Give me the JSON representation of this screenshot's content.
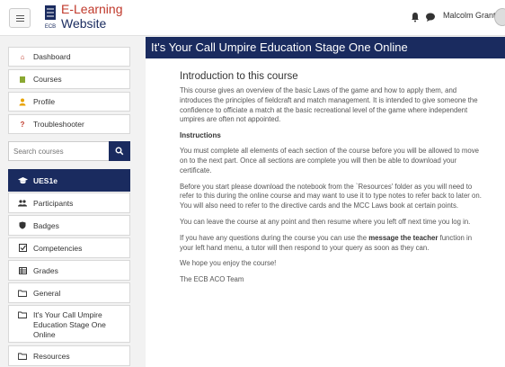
{
  "header": {
    "brand_line1": "E-Learning",
    "brand_line2": "Website",
    "user_name": "Malcolm Grant",
    "crest_text": "ECB"
  },
  "sidebar": {
    "items_top": [
      {
        "label": "Dashboard",
        "icon": "home-icon"
      },
      {
        "label": "Courses",
        "icon": "book-icon"
      },
      {
        "label": "Profile",
        "icon": "user-icon"
      },
      {
        "label": "Troubleshooter",
        "icon": "question-icon"
      }
    ],
    "search_placeholder": "Search courses",
    "course_title": "UES1e",
    "course_items": [
      {
        "label": "Participants",
        "icon": "users-icon"
      },
      {
        "label": "Badges",
        "icon": "shield-icon"
      },
      {
        "label": "Competencies",
        "icon": "checkbox-icon"
      },
      {
        "label": "Grades",
        "icon": "table-icon"
      },
      {
        "label": "General",
        "icon": "folder-icon"
      },
      {
        "label": "It's Your Call Umpire Education Stage One Online",
        "icon": "folder-icon"
      },
      {
        "label": "Resources",
        "icon": "folder-icon"
      }
    ]
  },
  "main": {
    "page_title": "It's Your Call Umpire Education Stage One Online",
    "intro_title": "Introduction to this course",
    "intro_text": "This course gives an overview of the basic Laws of the game and how to apply them, and introduces the principles of fieldcraft and match management. It is intended to give someone the confidence to officiate a match at the basic recreational level of the game where independent umpires are often not appointed.",
    "instructions_heading": "Instructions",
    "p1": "You must complete all elements of each section of the course before you will be allowed to move on to the next part. Once all sections are complete you will then be able to download your certificate.",
    "p2": "Before you start please download the notebook from the `Resources' folder as you will need to refer to this during the online course and may want to use it to type notes to refer back to later on. You will also need to refer to the directive cards and the MCC Laws book at certain points.",
    "p3": "You can leave the course at any point and then resume where you left off next time you log in.",
    "p4_before": "If you have any questions during the course you can use the ",
    "p4_bold": "message the teacher",
    "p4_after": " function in your left hand menu, a tutor will then respond to your query as soon as they can.",
    "p5": "We hope you enjoy the course!",
    "p6": "The ECB ACO Team"
  },
  "colors": {
    "navy": "#1a2b5f",
    "brand_red": "#c0392b"
  }
}
